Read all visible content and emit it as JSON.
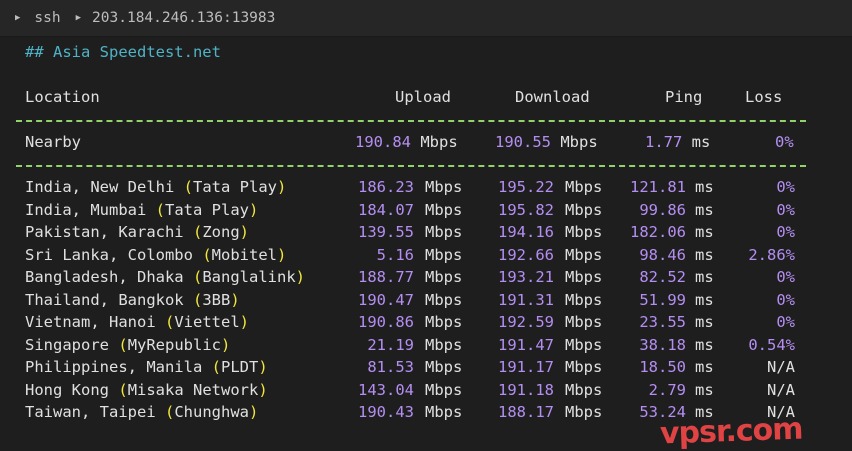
{
  "titlebar": {
    "app": "ssh",
    "host": "203.184.246.136:13983"
  },
  "heading": "## Asia Speedtest.net",
  "columns": {
    "location": "Location",
    "upload": "Upload",
    "download": "Download",
    "ping": "Ping",
    "loss": "Loss"
  },
  "units": {
    "speed": "Mbps",
    "ping": "ms"
  },
  "nearby": {
    "location": "Nearby",
    "upload": "190.84",
    "download": "190.55",
    "ping": "1.77",
    "loss": "0%"
  },
  "rows": [
    {
      "loc": "India, New Delhi",
      "isp": "Tata Play",
      "upload": "186.23",
      "download": "195.22",
      "ping": "121.81",
      "loss": "0%"
    },
    {
      "loc": "India, Mumbai",
      "isp": "Tata Play",
      "upload": "184.07",
      "download": "195.82",
      "ping": "99.86",
      "loss": "0%"
    },
    {
      "loc": "Pakistan, Karachi",
      "isp": "Zong",
      "upload": "139.55",
      "download": "194.16",
      "ping": "182.06",
      "loss": "0%"
    },
    {
      "loc": "Sri Lanka, Colombo",
      "isp": "Mobitel",
      "upload": "5.16",
      "download": "192.66",
      "ping": "98.46",
      "loss": "2.86%"
    },
    {
      "loc": "Bangladesh, Dhaka",
      "isp": "Banglalink",
      "upload": "188.77",
      "download": "193.21",
      "ping": "82.52",
      "loss": "0%"
    },
    {
      "loc": "Thailand, Bangkok",
      "isp": "3BB",
      "upload": "190.47",
      "download": "191.31",
      "ping": "51.99",
      "loss": "0%"
    },
    {
      "loc": "Vietnam, Hanoi",
      "isp": "Viettel",
      "upload": "190.86",
      "download": "192.59",
      "ping": "23.55",
      "loss": "0%"
    },
    {
      "loc": "Singapore",
      "isp": "MyRepublic",
      "upload": "21.19",
      "download": "191.47",
      "ping": "38.18",
      "loss": "0.54%"
    },
    {
      "loc": "Philippines, Manila",
      "isp": "PLDT",
      "upload": "81.53",
      "download": "191.17",
      "ping": "18.50",
      "loss": "N/A"
    },
    {
      "loc": "Hong Kong",
      "isp": "Misaka Network",
      "upload": "143.04",
      "download": "191.18",
      "ping": "2.79",
      "loss": "N/A"
    },
    {
      "loc": "Taiwan, Taipei",
      "isp": "Chunghwa",
      "upload": "190.43",
      "download": "188.17",
      "ping": "53.24",
      "loss": "N/A"
    }
  ],
  "watermark": "vpsr.com",
  "colors": {
    "background": "#1e1e1e",
    "heading": "#4fb3c7",
    "number": "#b48ef2",
    "paren": "#f0e63c",
    "separator": "#8fd36a"
  }
}
